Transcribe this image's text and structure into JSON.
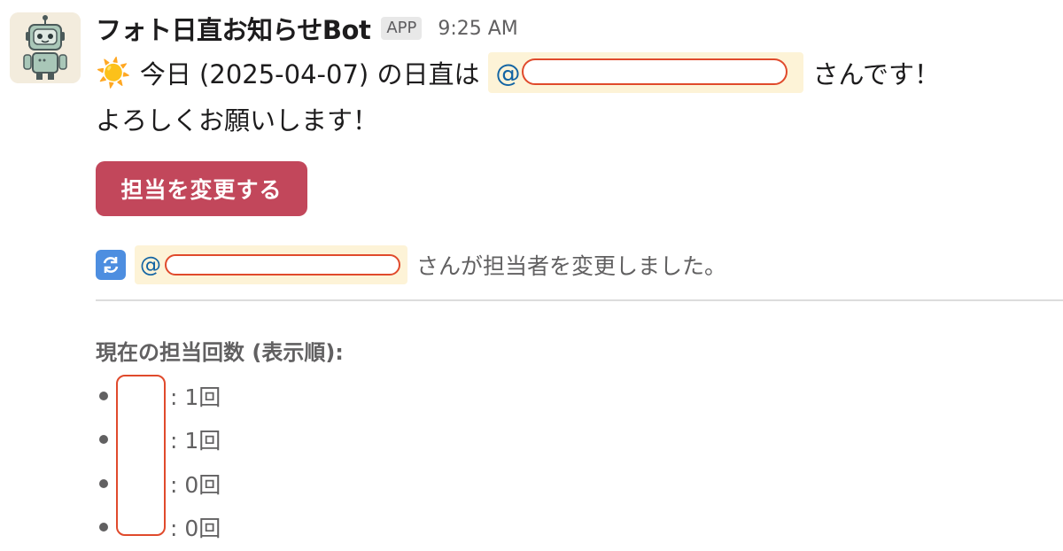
{
  "message": {
    "bot_name": "フォト日直お知らせBot",
    "app_badge": "APP",
    "timestamp": "9:25 AM",
    "line1_emoji": "☀️",
    "line1_before": "今日 (2025-04-07) の日直は",
    "line1_mention": "@",
    "line1_after": "さんです！",
    "line2": "よろしくお願いします！"
  },
  "actions": {
    "change_button_label": "担当を変更する"
  },
  "context": {
    "mention": "@",
    "text": "さんが担当者を変更しました。"
  },
  "counts": {
    "title": "現在の担当回数 (表示順):",
    "items": [
      {
        "count": ": 1回"
      },
      {
        "count": ": 1回"
      },
      {
        "count": ": 0回"
      },
      {
        "count": ": 0回"
      }
    ]
  },
  "colors": {
    "button": "#c2475b",
    "mention_bg": "#fdf3d7",
    "mention_text": "#1264a3",
    "redaction": "#e04a2c"
  },
  "icons": {
    "avatar": "robot-avatar",
    "refresh": "refresh-icon"
  }
}
